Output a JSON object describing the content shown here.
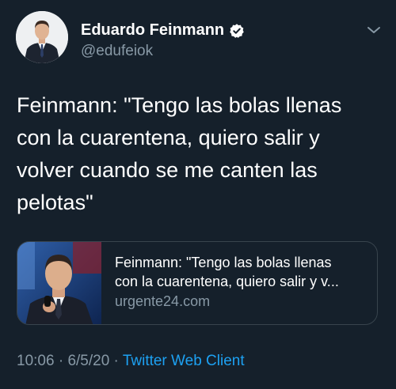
{
  "author": {
    "name": "Eduardo Feinmann",
    "handle": "@edufeiok",
    "verified": true
  },
  "tweet": {
    "text": "Feinmann: \"Tengo las bolas llenas con la cuarentena, quiero salir y volver cuando se me canten las pelotas\""
  },
  "card": {
    "title_line1": "Feinmann: \"Tengo las bolas llenas",
    "title_line2": "con la cuarentena, quiero salir y v...",
    "domain": "urgente24.com"
  },
  "meta": {
    "time": "10:06",
    "separator1": " · ",
    "date": "6/5/20",
    "separator2": " · ",
    "source": "Twitter Web Client"
  },
  "icons": {
    "verified": "verified-badge-icon",
    "menu": "chevron-down-icon"
  },
  "colors": {
    "background": "#15202b",
    "secondary_text": "#8899a6",
    "link": "#1da1f2",
    "border": "#38444d"
  }
}
